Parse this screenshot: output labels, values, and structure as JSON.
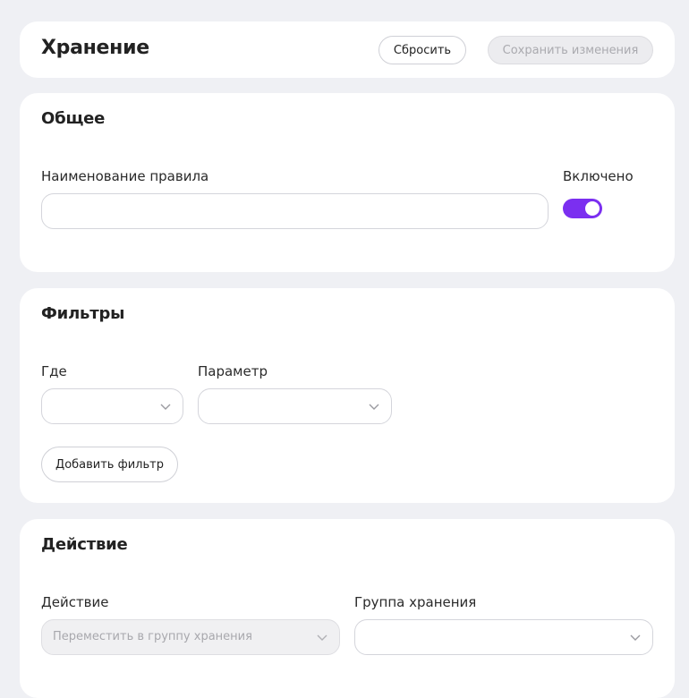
{
  "header": {
    "title": "Хранение",
    "reset_label": "Сбросить",
    "save_label": "Сохранить изменения"
  },
  "general": {
    "title": "Общее",
    "rule_name_label": "Наименование правила",
    "rule_name_value": "",
    "enabled_label": "Включено",
    "enabled": true
  },
  "filters": {
    "title": "Фильтры",
    "where_label": "Где",
    "where_value": "",
    "param_label": "Параметр",
    "param_value": "",
    "add_filter_label": "Добавить фильтр"
  },
  "action": {
    "title": "Действие",
    "action_label": "Действие",
    "action_value": "Переместить в группу хранения",
    "group_label": "Группа хранения",
    "group_value": ""
  },
  "colors": {
    "accent": "#7b2ff0",
    "background": "#eff0f4",
    "card": "#ffffff"
  },
  "icons": {
    "select_chevron": "chevron-down-icon"
  }
}
